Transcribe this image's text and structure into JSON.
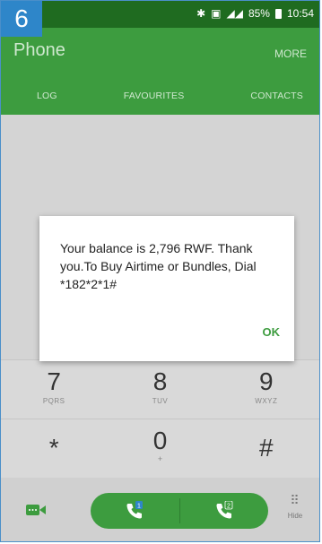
{
  "step_badge": "6",
  "status_bar": {
    "battery": "85%",
    "time": "10:54"
  },
  "app_bar": {
    "title": "Phone",
    "more_label": "MORE"
  },
  "tabs": [
    {
      "label": "LOG"
    },
    {
      "label": "FAVOURITES"
    },
    {
      "label": "CONTACTS"
    }
  ],
  "keypad": {
    "row1": [
      {
        "digit": "7",
        "letters": "PQRS"
      },
      {
        "digit": "8",
        "letters": "TUV"
      },
      {
        "digit": "9",
        "letters": "WXYZ"
      }
    ],
    "row2": [
      {
        "symbol": "*"
      },
      {
        "digit": "0",
        "sub": "+"
      },
      {
        "symbol": "#"
      }
    ]
  },
  "call_bar": {
    "sim1_badge": "1",
    "sim2_badge": "2",
    "hide_label": "Hide"
  },
  "dialog": {
    "message": "Your balance is 2,796 RWF. Thank you.To Buy Airtime or Bundles, Dial *182*2*1#",
    "ok_label": "OK"
  },
  "colors": {
    "status_green": "#1f6b20",
    "app_green": "#3d9c3f",
    "badge_blue": "#2e86c9"
  }
}
